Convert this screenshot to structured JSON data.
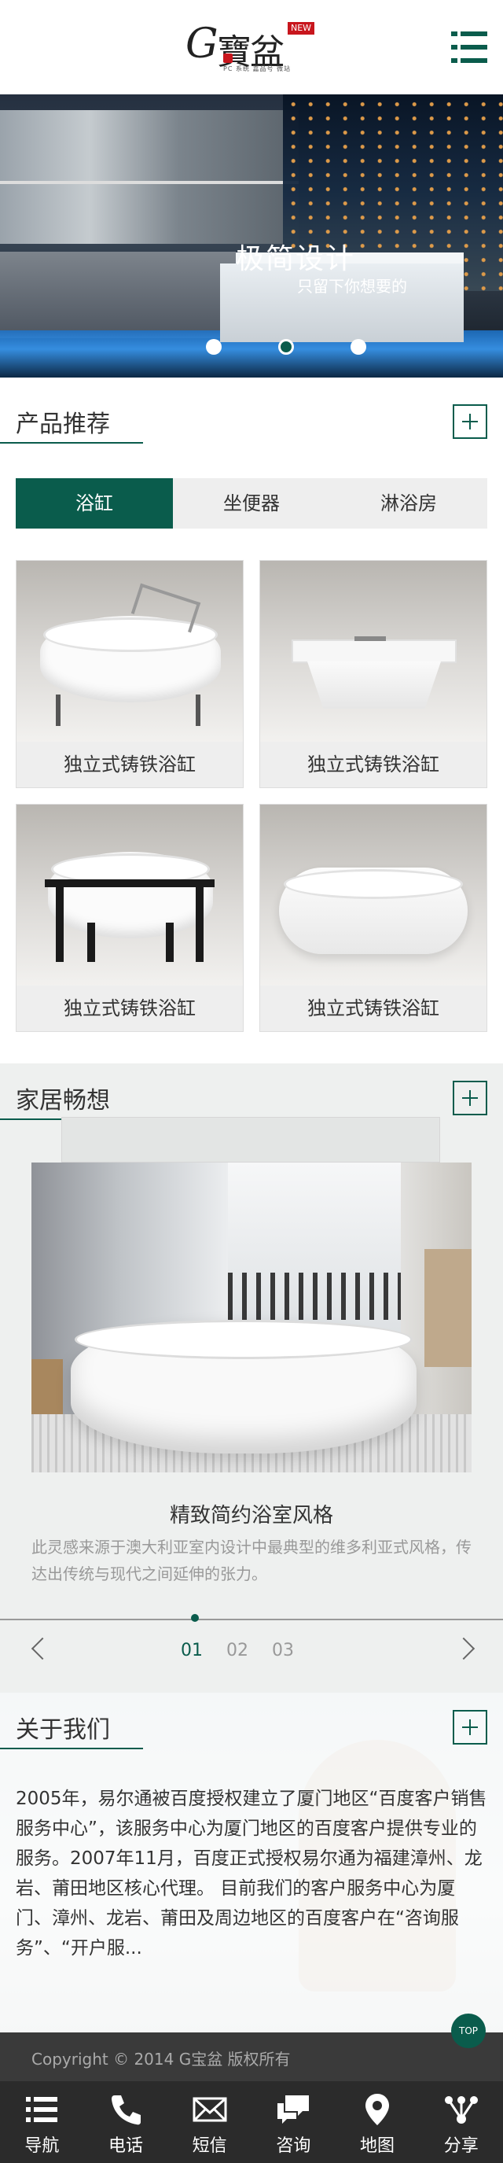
{
  "header": {
    "logo_letter": "G",
    "logo_text": "寶盆",
    "logo_badge": "NEW",
    "logo_subtitle": "PC 系统 嘉品号 微站"
  },
  "banner": {
    "title": "极简设计",
    "subtitle": "只留下你想要的",
    "slides": 3,
    "active_slide": 2
  },
  "products": {
    "section_title": "产品推荐",
    "tabs": [
      "浴缸",
      "坐便器",
      "淋浴房"
    ],
    "active_tab": 0,
    "items": [
      {
        "caption": "独立式铸铁浴缸"
      },
      {
        "caption": "独立式铸铁浴缸"
      },
      {
        "caption": "独立式铸铁浴缸"
      },
      {
        "caption": "独立式铸铁浴缸"
      }
    ]
  },
  "ideas": {
    "section_title": "家居畅想",
    "title": "精致简约浴室风格",
    "description": "此灵感来源于澳大利亚室内设计中最典型的维多利亚式风格，传达出传统与现代之间延伸的张力。",
    "pages": [
      "01",
      "02",
      "03"
    ],
    "active_page": 0
  },
  "about": {
    "section_title": "关于我们",
    "text": "2005年，易尔通被百度授权建立了厦门地区“百度客户销售服务中心”，该服务中心为厦门地区的百度客户提供专业的服务。2007年11月，百度正式授权易尔通为福建漳州、龙岩、莆田地区核心代理。 目前我们的客户服务中心为厦门、漳州、龙岩、莆田及周边地区的百度客户在“咨询服务”、“开户服..."
  },
  "footer": {
    "copyright": "Copyright © 2014 G宝盆 版权所有",
    "top_label": "TOP"
  },
  "navbar": [
    {
      "label": "导航",
      "icon": "list-icon"
    },
    {
      "label": "电话",
      "icon": "phone-icon"
    },
    {
      "label": "短信",
      "icon": "mail-icon"
    },
    {
      "label": "咨询",
      "icon": "chat-icon"
    },
    {
      "label": "地图",
      "icon": "map-pin-icon"
    },
    {
      "label": "分享",
      "icon": "share-icon"
    }
  ],
  "colors": {
    "accent": "#0a5c4c",
    "footer_bg": "#3a3a3a",
    "navbar_bg": "#2b2b2b"
  }
}
